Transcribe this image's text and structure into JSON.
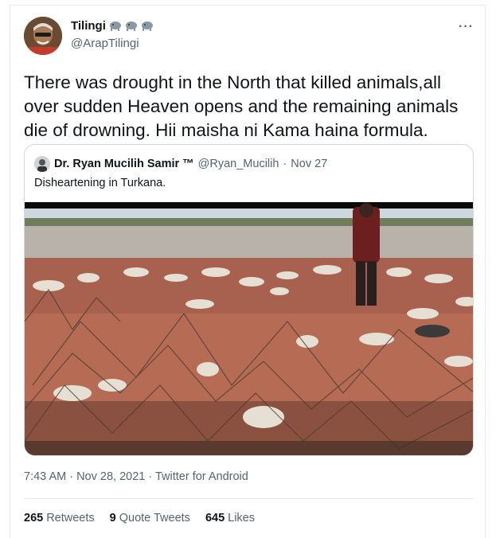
{
  "tweet": {
    "author_name": "Tilingi",
    "author_emoji": [
      "elephant-icon",
      "elephant-icon",
      "elephant-icon"
    ],
    "handle": "@ArapTilingi",
    "more_icon": "more-dots-icon",
    "text": "There was drought in the North that killed animals,all over sudden Heaven opens and the remaining animals die of drowning. Hii maisha ni Kama haina formula.",
    "timestamp": "7:43 AM · Nov 28, 2021 · Twitter for Android"
  },
  "quote": {
    "author_name": "Dr. Ryan Mucilih Samir ™",
    "handle": "@Ryan_Mucilih",
    "separator": "·",
    "date": "Nov 27",
    "text": "Disheartening in Turkana."
  },
  "stats": {
    "retweets_count": "265",
    "retweets_label": "Retweets",
    "quotes_count": "9",
    "quotes_label": "Quote Tweets",
    "likes_count": "645",
    "likes_label": "Likes"
  },
  "colors": {
    "text": "#0f1419",
    "secondary": "#536471",
    "border": "#cfd9de"
  }
}
